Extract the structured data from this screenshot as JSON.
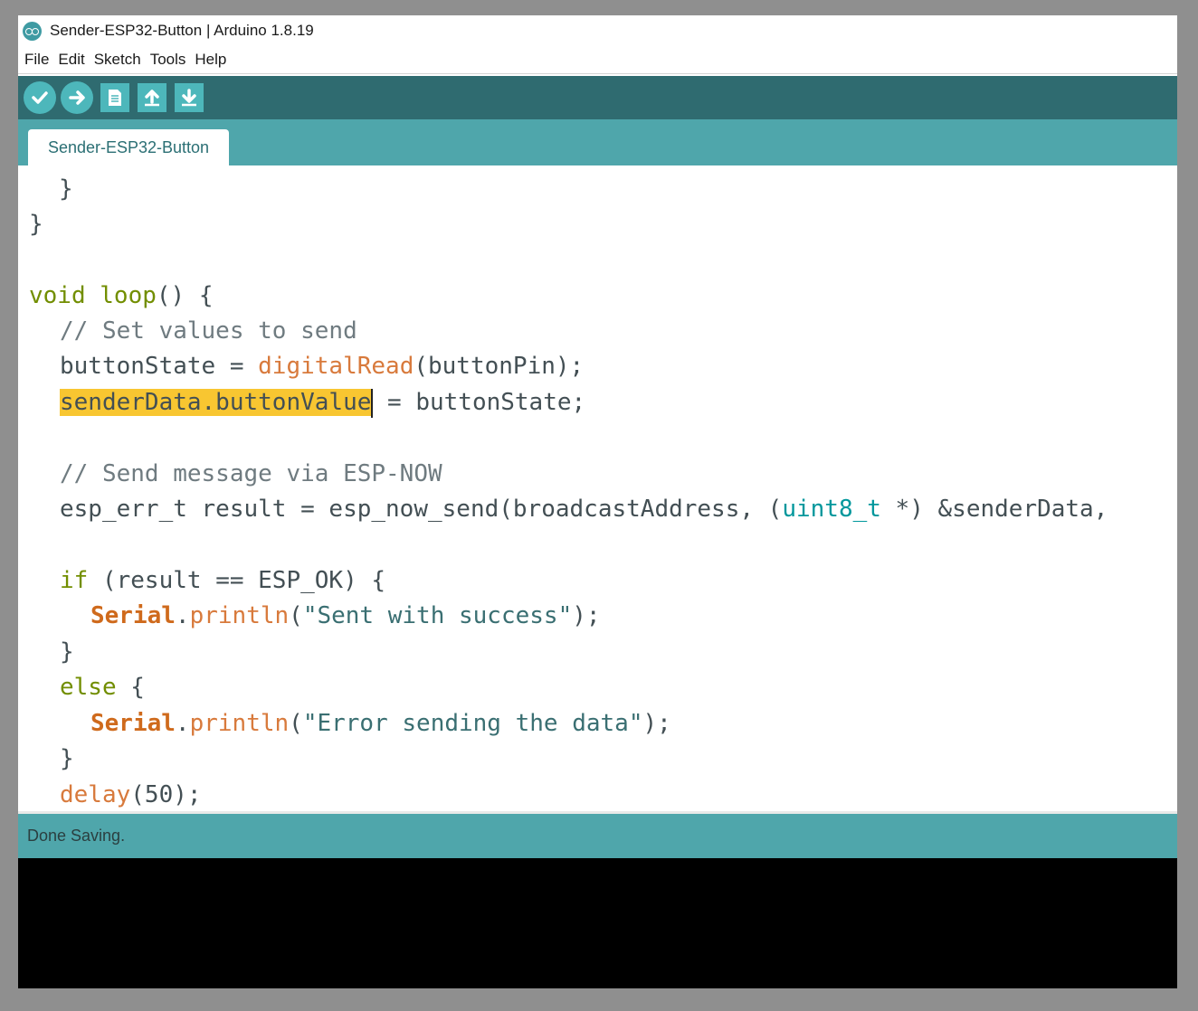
{
  "window": {
    "title": "Sender-ESP32-Button | Arduino 1.8.19"
  },
  "menu": {
    "items": [
      "File",
      "Edit",
      "Sketch",
      "Tools",
      "Help"
    ]
  },
  "toolbar": {
    "buttons": [
      {
        "name": "verify",
        "icon": "check-icon"
      },
      {
        "name": "upload",
        "icon": "arrow-right-icon"
      },
      {
        "name": "new",
        "icon": "new-file-icon"
      },
      {
        "name": "open",
        "icon": "arrow-up-icon"
      },
      {
        "name": "save",
        "icon": "arrow-down-icon"
      }
    ]
  },
  "tabs": [
    {
      "label": "Sender-ESP32-Button"
    }
  ],
  "code": {
    "l1": "}",
    "l2": "}",
    "l3": {
      "kw": "void",
      "fn": "loop",
      "rest": "() {"
    },
    "l4": "// Set values to send",
    "l5": {
      "a": "buttonState = ",
      "fn": "digitalRead",
      "b": "(buttonPin);"
    },
    "l6": {
      "sel": "senderData.buttonValue",
      "b": " = buttonState;"
    },
    "l7": "// Send message via ESP-NOW",
    "l8": {
      "a": "esp_err_t result = esp_now_send(broadcastAddress, (",
      "type": "uint8_t",
      "b": " *) &senderData,"
    },
    "l9": {
      "kw": "if",
      "b": " (result == ESP_OK) {"
    },
    "l10": {
      "obj": "Serial",
      "dot": ".",
      "fn": "println",
      "p1": "(",
      "s": "\"Sent with success\"",
      "p2": ");"
    },
    "l11": "}",
    "l12": {
      "kw": "else",
      "b": " {"
    },
    "l13": {
      "obj": "Serial",
      "dot": ".",
      "fn": "println",
      "p1": "(",
      "s": "\"Error sending the data\"",
      "p2": ");"
    },
    "l14": "}",
    "l15": {
      "fn": "delay",
      "b": "(50);"
    }
  },
  "status": {
    "message": "Done Saving."
  },
  "colors": {
    "toolbar": "#2f6b70",
    "accent": "#4fa6ab",
    "button": "#4db7bb",
    "highlight": "#f8c631"
  }
}
